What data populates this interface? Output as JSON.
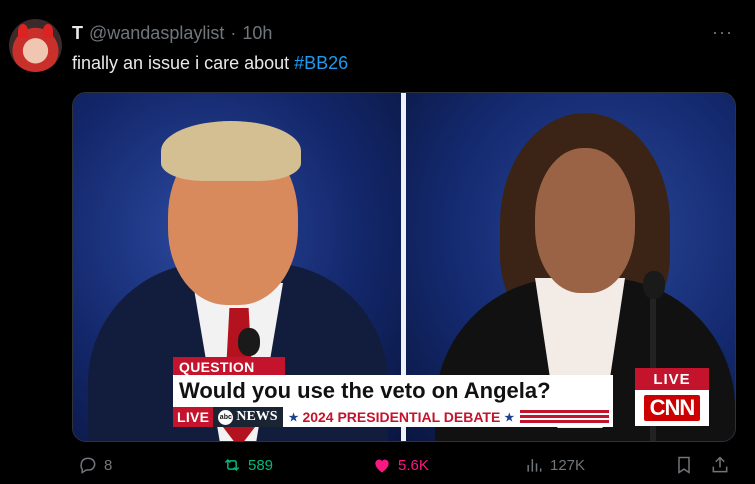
{
  "tweet": {
    "display_name": "T",
    "handle": "@wandasplaylist",
    "separator": "·",
    "time": "10h",
    "text": "finally an issue i care about ",
    "hashtag": "#BB26",
    "more": "···"
  },
  "media": {
    "chyron": {
      "label": "QUESTION",
      "headline": "Would you use the veto on Angela?",
      "live_left": "LIVE",
      "network": "NEWS",
      "abc_mark": "abc",
      "star": "★",
      "event": "2024 PRESIDENTIAL DEBATE",
      "live_right": "LIVE",
      "channel": "CNN"
    }
  },
  "actions": {
    "replies": "8",
    "reposts": "589",
    "likes": "5.6K",
    "views": "127K"
  },
  "colors": {
    "accent": "#1d9bf0",
    "repost": "#00ba7c",
    "like": "#f91880",
    "muted": "#71767b",
    "cnn_red": "#cc0000"
  },
  "icons": [
    "reply-icon",
    "repost-icon",
    "like-icon",
    "views-icon",
    "bookmark-icon",
    "share-icon",
    "more-icon"
  ]
}
